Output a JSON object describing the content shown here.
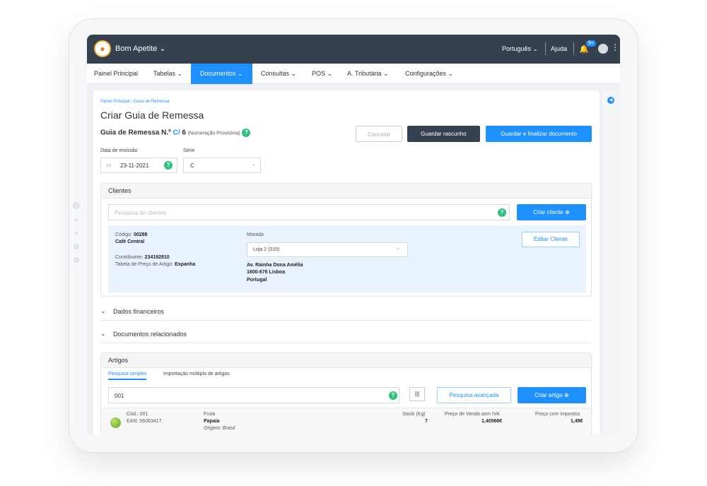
{
  "app": {
    "brand": "Bom Apetite ⌄",
    "language": "Português ⌄",
    "help": "Ajuda",
    "notifications_badge": "9+",
    "kebab": "⋮",
    "collapse_icon": "◀"
  },
  "menu": [
    {
      "label": "Painel Principal",
      "active": false
    },
    {
      "label": "Tabelas ⌄",
      "active": false
    },
    {
      "label": "Documentos ⌄",
      "active": true
    },
    {
      "label": "Consultas ⌄",
      "active": false
    },
    {
      "label": "POS ⌄",
      "active": false
    },
    {
      "label": "A. Tributária ⌄",
      "active": false
    },
    {
      "label": "Configurações ⌄",
      "active": false
    }
  ],
  "breadcrumb": {
    "home": "Painel Principal",
    "separator": "|",
    "current": "Guias de Remessa"
  },
  "page": {
    "title": "Criar Guia de Remessa",
    "doc_label": "Guia de Remessa N.º",
    "doc_number": "C/",
    "doc_seq": "6",
    "doc_note": "(Numeração Provisória)",
    "help": "?"
  },
  "actions": {
    "cancel": "Cancelar",
    "draft": "Guardar rascunho",
    "finalize": "Guardar e finalizar documento"
  },
  "form": {
    "issue_date_label": "Data de emissão",
    "issue_date": "23-11-2021",
    "series_label": "Série",
    "series": "C",
    "calendar_icon": "▭",
    "chevron": "⌄"
  },
  "clients": {
    "title": "Clientes",
    "search_placeholder": "Pesquisa de clientes",
    "create_button": "Criar cliente ⊕",
    "code_label": "Código:",
    "code": "00288",
    "name": "Café Central",
    "taxpayer_label": "Contribuinte:",
    "taxpayer": "234192810",
    "price_table_label": "Tabela de Preço de Artigo:",
    "price_table": "Espanha",
    "address_label": "Morada",
    "address_selected": "Loja 2 (015)",
    "address_line1": "Av. Rainha Dona Amélia",
    "address_line2": "1600-676 Lisboa",
    "address_line3": "Portugal",
    "edit_button": "Editar Cliente"
  },
  "sections": {
    "financial": "Dados financeiros",
    "related": "Documentos relacionados",
    "arrow": "⌄"
  },
  "articles": {
    "title": "Artigos",
    "tab_simple": "Pesquisa simples",
    "tab_multi": "Importação múltipla de artigos",
    "search_value": "001",
    "barcode_icon": "|||",
    "advanced_button": "Pesquisa avançada",
    "create_button": "Criar artigo ⊕",
    "row": {
      "code": "Cód.: 001",
      "ean": "EAN: 56063417",
      "category": "Fruta",
      "name": "Papaia",
      "origin": "Origem: Brasil",
      "stock_label": "Stock (Kg)",
      "stock": "7",
      "price_label": "Preço de Venda sem IVA",
      "price": "1,40566€",
      "price_tax_label": "Preço com impostos",
      "price_tax": "1,49€"
    }
  },
  "colors": {
    "topbar": "#364150",
    "accent": "#1f90ff",
    "help_green": "#2ec27e",
    "client_box": "#e8f3fd"
  }
}
